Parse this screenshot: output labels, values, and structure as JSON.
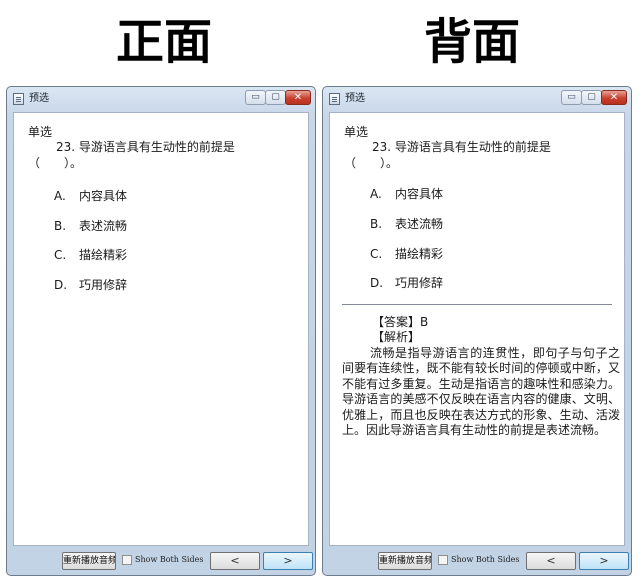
{
  "headings": {
    "front": "正面",
    "back": "背面"
  },
  "window": {
    "title": "预选",
    "minimize_symbol": "▭",
    "maximize_symbol": "▢",
    "close_symbol": "✕"
  },
  "question": {
    "type": "单选",
    "text": "23. 导游语言具有生动性的前提是（　　）。",
    "options": [
      {
        "letter": "A.",
        "text": "内容具体"
      },
      {
        "letter": "B.",
        "text": "表述流畅"
      },
      {
        "letter": "C.",
        "text": "描绘精彩"
      },
      {
        "letter": "D.",
        "text": "巧用修辞"
      }
    ]
  },
  "answer": {
    "answer_line": "【答案】B",
    "analysis_label": "【解析】",
    "explanation": "流畅是指导游语言的连贯性，即句子与句子之间要有连续性，既不能有较长时间的停顿或中断，又不能有过多重复。生动是指语言的趣味性和感染力。导游语言的美感不仅反映在语言内容的健康、文明、优雅上，而且也反映在表达方式的形象、生动、活泼上。因此导游语言具有生动性的前提是表述流畅。"
  },
  "bottom_bar": {
    "replay_label": "重新播放音频",
    "show_both_label": "Show Both Sides",
    "show_both_checked": false,
    "prev_symbol": "<",
    "next_symbol": ">"
  }
}
